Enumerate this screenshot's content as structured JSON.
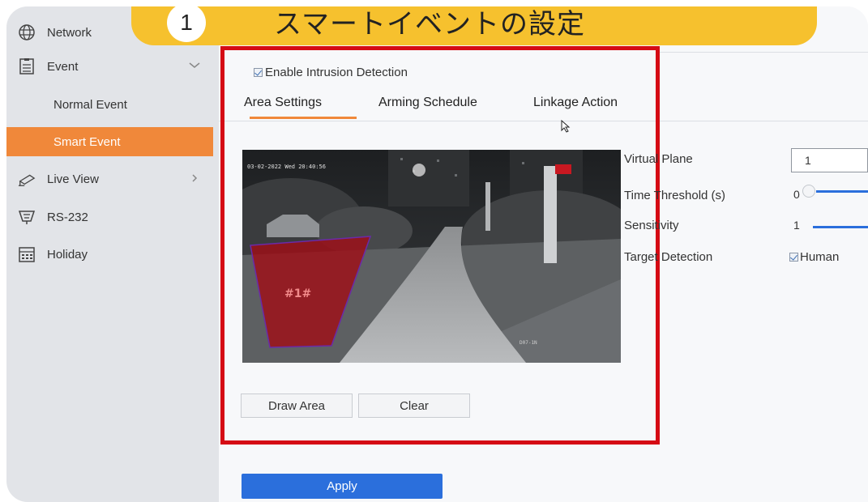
{
  "banner": {
    "number": "1",
    "title": "スマートイベントの設定"
  },
  "sidebar": {
    "items": [
      {
        "label": "Network",
        "icon": "globe-icon"
      },
      {
        "label": "Event",
        "icon": "list-icon"
      },
      {
        "label": "Normal Event"
      },
      {
        "label": "Smart Event"
      },
      {
        "label": "Live View",
        "icon": "camera-icon"
      },
      {
        "label": "RS-232",
        "icon": "serial-port-icon"
      },
      {
        "label": "Holiday",
        "icon": "calendar-icon"
      }
    ]
  },
  "main": {
    "enable_label": "Enable Intrusion Detection",
    "tabs": [
      {
        "label": "Area Settings",
        "active": true
      },
      {
        "label": "Arming Schedule"
      },
      {
        "label": "Linkage Action"
      }
    ],
    "camera": {
      "timestamp": "03-02-2022 Wed 20:40:56",
      "area_label": "#1#",
      "channel_label": "D07-1N"
    },
    "buttons": {
      "draw_area": "Draw Area",
      "clear": "Clear",
      "apply": "Apply"
    },
    "settings": {
      "virtual_plane_label": "Virtual Plane",
      "virtual_plane_value": "1",
      "time_threshold_label": "Time Threshold (s)",
      "time_threshold_value": "0",
      "sensitivity_label": "Sensitivity",
      "sensitivity_value": "1",
      "target_detection_label": "Target Detection",
      "target_human_label": "Human"
    }
  },
  "colors": {
    "accent": "#f0883a",
    "highlight": "#d50b14",
    "banner": "#f6c12e",
    "primary": "#2b6fdc"
  }
}
